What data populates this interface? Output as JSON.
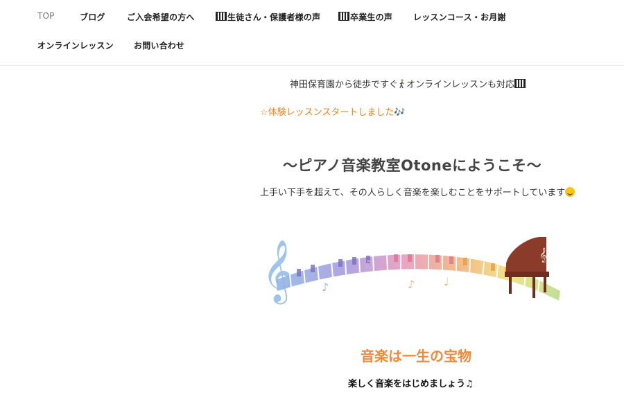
{
  "nav": {
    "row1": [
      "TOP",
      "ブログ",
      "ご入会希望の方へ",
      "生徒さん・保護者様の声",
      "卒業生の声",
      "レッスンコース・お月謝"
    ],
    "row2": [
      "オンラインレッスン",
      "お問い合わせ"
    ]
  },
  "main": {
    "line1": "神田保育園から徒歩ですぐ",
    "line1b": "オンラインレッスンも対応",
    "line2": "☆体験レッスンスタートしました🎶",
    "heading": "〜ピアノ音楽教室Otoneにようこそ〜",
    "paragraph": "上手い下手を超えて、その人らしく音楽を楽しむことをサポートしています",
    "subheading": "音楽は一生の宝物",
    "tagline": "楽しく音楽をはじめましょう♫"
  },
  "colors": {
    "accent_orange": "#ef8a3c",
    "nav_active": "#777777"
  },
  "icons": [
    "piano-keyboard-icon",
    "walking-person-icon",
    "smile-emoji-icon",
    "music-notes-icon"
  ]
}
